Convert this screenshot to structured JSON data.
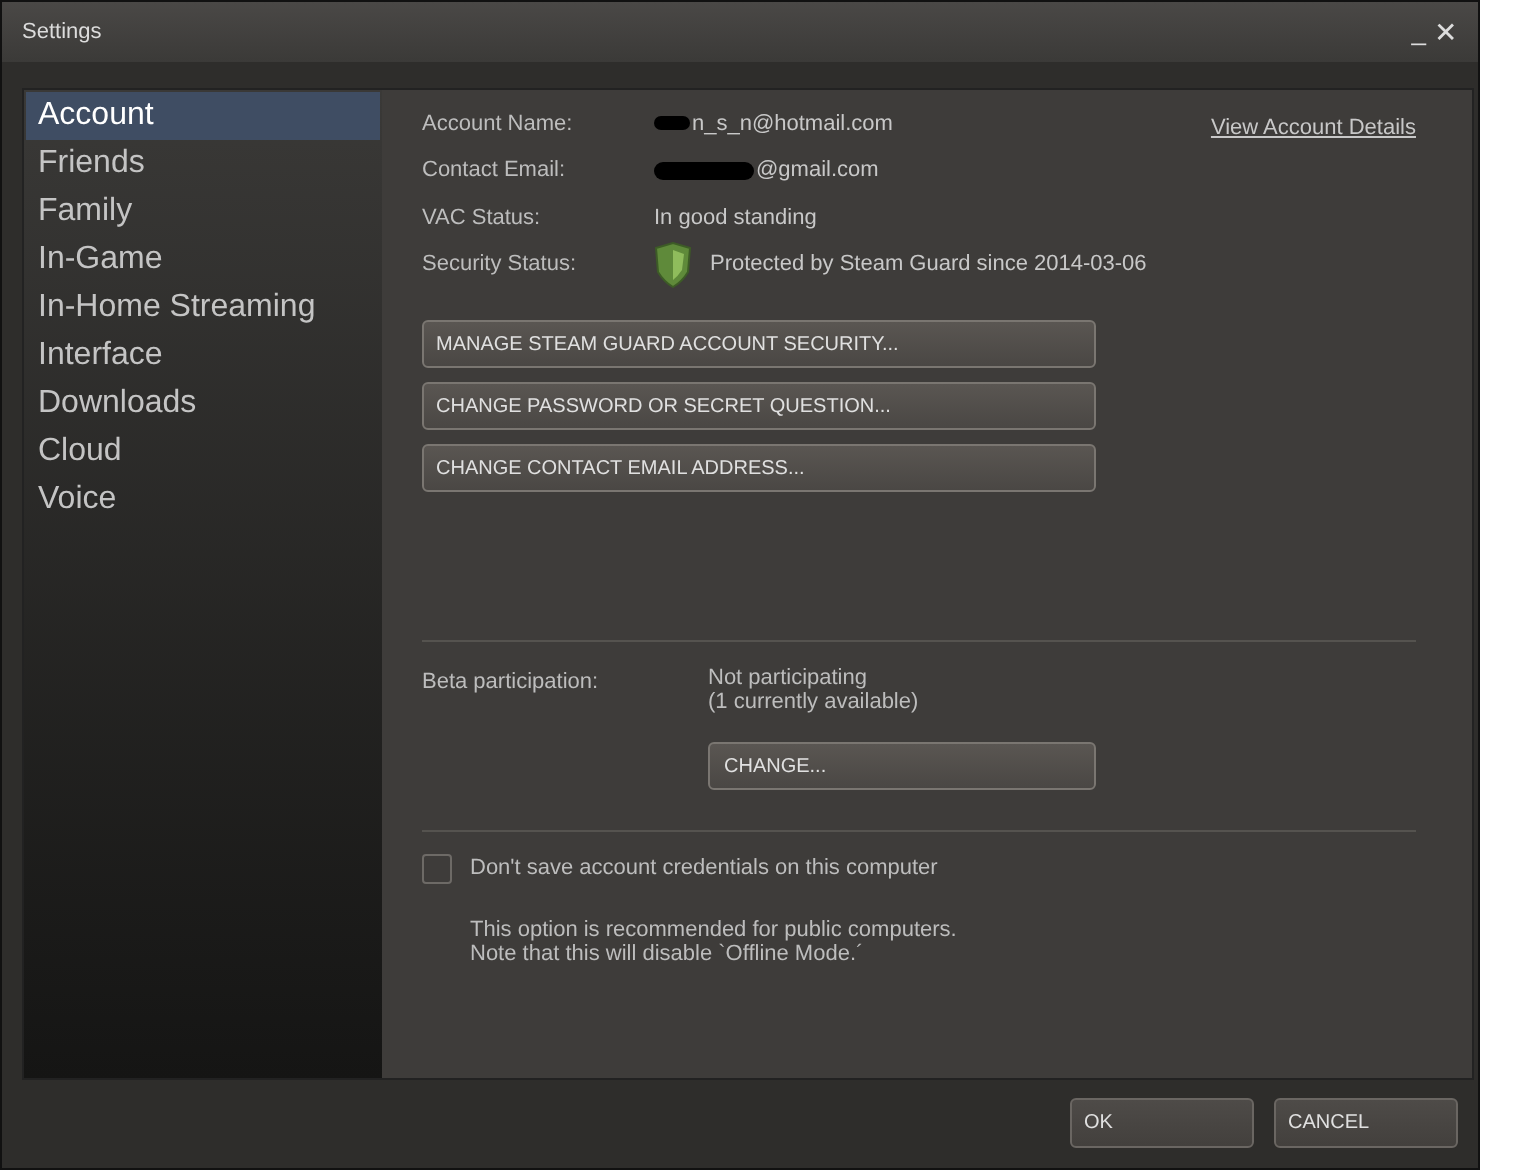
{
  "window": {
    "title": "Settings",
    "controls": [
      "_",
      "✕"
    ]
  },
  "sidebar": {
    "items": [
      {
        "label": "Account",
        "selected": true
      },
      {
        "label": "Friends",
        "selected": false
      },
      {
        "label": "Family",
        "selected": false
      },
      {
        "label": "In-Game",
        "selected": false
      },
      {
        "label": "In-Home Streaming",
        "selected": false
      },
      {
        "label": "Interface",
        "selected": false
      },
      {
        "label": "Downloads",
        "selected": false
      },
      {
        "label": "Cloud",
        "selected": false
      },
      {
        "label": "Voice",
        "selected": false
      }
    ]
  },
  "account": {
    "fields": [
      {
        "label": "Account Name:",
        "value": "n_s_n@hotmail.com",
        "redacted": true,
        "kind": "text"
      },
      {
        "label": "Contact Email:",
        "value": "@gmail.com",
        "redacted": true,
        "kind": "text"
      },
      {
        "label": "VAC Status:",
        "value": "In good standing",
        "redacted": false,
        "kind": "text"
      },
      {
        "label": "Security Status:",
        "value": "Protected by Steam Guard since 2014-03-06",
        "redacted": false,
        "kind": "shield"
      }
    ],
    "link": "View Account Details",
    "buttons": [
      "MANAGE STEAM GUARD ACCOUNT SECURITY...",
      "CHANGE PASSWORD OR SECRET QUESTION...",
      "CHANGE CONTACT EMAIL ADDRESS..."
    ]
  },
  "beta": {
    "label": "Beta participation:",
    "lines": [
      "Not participating",
      "(1 currently available)"
    ],
    "button": "CHANGE..."
  },
  "credentials": {
    "label": "Don't save account credentials on this computer",
    "checked": false,
    "note": [
      "This option is recommended for public computers.",
      "Note that this will disable `Offline Mode.´"
    ]
  },
  "footer": {
    "buttons": [
      "OK",
      "CANCEL"
    ]
  }
}
